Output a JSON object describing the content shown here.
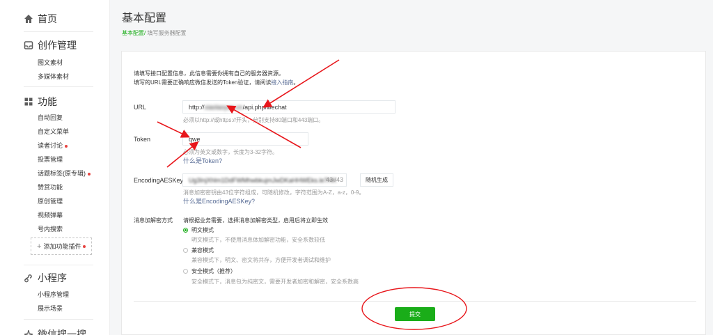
{
  "sidebar": {
    "home": "首页",
    "creation": {
      "title": "创作管理",
      "items": [
        "图文素材",
        "多媒体素材"
      ]
    },
    "features": {
      "title": "功能",
      "items": [
        {
          "label": "自动回复",
          "dot": false
        },
        {
          "label": "自定义菜单",
          "dot": false
        },
        {
          "label": "读者讨论",
          "dot": true
        },
        {
          "label": "投票管理",
          "dot": false
        },
        {
          "label": "话题标签(原专辑)",
          "dot": true
        },
        {
          "label": "赞赏功能",
          "dot": false
        },
        {
          "label": "原创管理",
          "dot": false
        },
        {
          "label": "视频弹幕",
          "dot": false
        },
        {
          "label": "号内搜索",
          "dot": false
        }
      ],
      "add_plugin": "添加功能插件"
    },
    "miniprogram": {
      "title": "小程序",
      "items": [
        "小程序管理",
        "展示场景"
      ]
    },
    "wechat_search": {
      "title": "微信搜一搜"
    }
  },
  "header": {
    "title": "基本配置",
    "breadcrumb_active": "基本配置/",
    "breadcrumb_current": "填写服务器配置"
  },
  "form": {
    "tips_line1": "请填写接口配置信息，此信息需要你拥有自己的服务器资源。",
    "tips_line2_prefix": "填写的URL需要正确响应微信发送的Token验证，请阅读",
    "tips_line2_link": "接入指南",
    "tips_line2_suffix": "。",
    "url": {
      "label": "URL",
      "value_prefix": "http://",
      "value_blurred": "xiaolaoyun.cn",
      "value_suffix": "/api.php/wechat",
      "hint": "必须以http://或https://开头，分别支持80端口和443端口。"
    },
    "token": {
      "label": "Token",
      "value": "qwe",
      "hint": "必须为英文或数字，长度为3-32字符。",
      "link": "什么是Token?"
    },
    "aes": {
      "label": "EncodingAESKey",
      "value": "Ug3InjXhlm1DdFWMhwbkujmJwDKaHHWEks.le7HK",
      "count": "43 /43",
      "random_button": "随机生成",
      "hint": "消息加密密钥由43位字符组成，可随机修改，字符范围为A-Z，a-z，0-9。",
      "link": "什么是EncodingAESKey?"
    },
    "encryption": {
      "label": "消息加解密方式",
      "intro": "请根据业务需要，选择消息加解密类型，启用后将立即生效",
      "options": [
        {
          "label": "明文模式",
          "desc": "明文模式下，不使用消息体加解密功能，安全系数较低",
          "checked": true
        },
        {
          "label": "兼容模式",
          "desc": "兼容模式下，明文、密文将共存，方便开发者调试和维护",
          "checked": false
        },
        {
          "label": "安全模式（推荐）",
          "desc": "安全模式下，消息包为纯密文，需要开发者加密和解密，安全系数高",
          "checked": false
        }
      ]
    },
    "submit": "提交"
  },
  "colors": {
    "accent": "#1aad19",
    "link": "#576b95",
    "annotation": "#e8161b"
  }
}
